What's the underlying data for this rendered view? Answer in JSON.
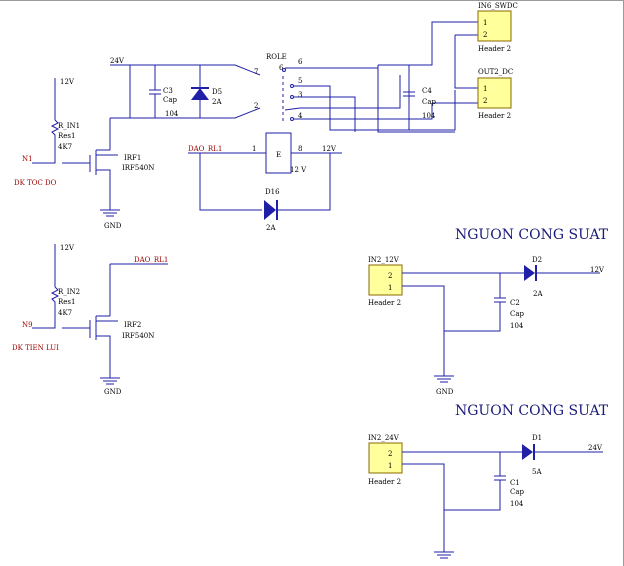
{
  "colors": {
    "wire": "#1f1fa8",
    "connector_fill": "#ffff9c",
    "net_label": "#a00000",
    "background": "#ffffff"
  },
  "power": {
    "v24": "24V",
    "v12": "12V"
  },
  "ground_label": "GND",
  "relay": {
    "ref": "ROLE",
    "coil_value": "12 V",
    "coil_letter": "E",
    "pins": [
      "7",
      "6",
      "6",
      "5",
      "3",
      "2",
      "1",
      "4",
      "1",
      "8"
    ]
  },
  "capacitors": {
    "c3": {
      "ref": "C3",
      "type": "Cap",
      "value": "104"
    },
    "c4": {
      "ref": "C4",
      "type": "Cap",
      "value": "104"
    },
    "c2": {
      "ref": "C2",
      "type": "Cap",
      "value": "104"
    },
    "c1": {
      "ref": "C1",
      "type": "Cap",
      "value": "104"
    }
  },
  "diodes": {
    "d5": {
      "ref": "D5",
      "value": "2A"
    },
    "d16": {
      "ref": "D16",
      "value": "2A"
    },
    "d2": {
      "ref": "D2",
      "value": "2A"
    },
    "d1": {
      "ref": "D1",
      "value": "5A"
    }
  },
  "resistors": {
    "r1": {
      "ref": "R_IN1",
      "type": "Res1",
      "value": "4K7"
    },
    "r2": {
      "ref": "R_IN2",
      "type": "Res1",
      "value": "4K7"
    }
  },
  "mosfets": {
    "irf1": {
      "ref": "IRF1",
      "value": "IRF540N"
    },
    "irf2": {
      "ref": "IRF2",
      "value": "IRF540N"
    }
  },
  "connectors": {
    "in6": {
      "ref": "IN6_SWDC",
      "type": "Header 2",
      "pins": [
        "1",
        "2"
      ]
    },
    "out2": {
      "ref": "OUT2_DC",
      "type": "Header 2",
      "pins": [
        "1",
        "2"
      ]
    },
    "in2_12": {
      "ref": "IN2_12V",
      "type": "Header 2",
      "pins": [
        "2",
        "1"
      ]
    },
    "in2_24": {
      "ref": "IN2_24V",
      "type": "Header 2",
      "pins": [
        "2",
        "1"
      ]
    }
  },
  "nets": {
    "n1": "N1",
    "n9": "N9",
    "dk_toc_do": "DK TOC DO",
    "dk_tien_lui": "DK TIEN LUI",
    "dao_rl1": "DAO_RL1"
  },
  "sections": {
    "nguon1": "NGUON CONG SUAT",
    "nguon2": "NGUON CONG SUAT"
  }
}
